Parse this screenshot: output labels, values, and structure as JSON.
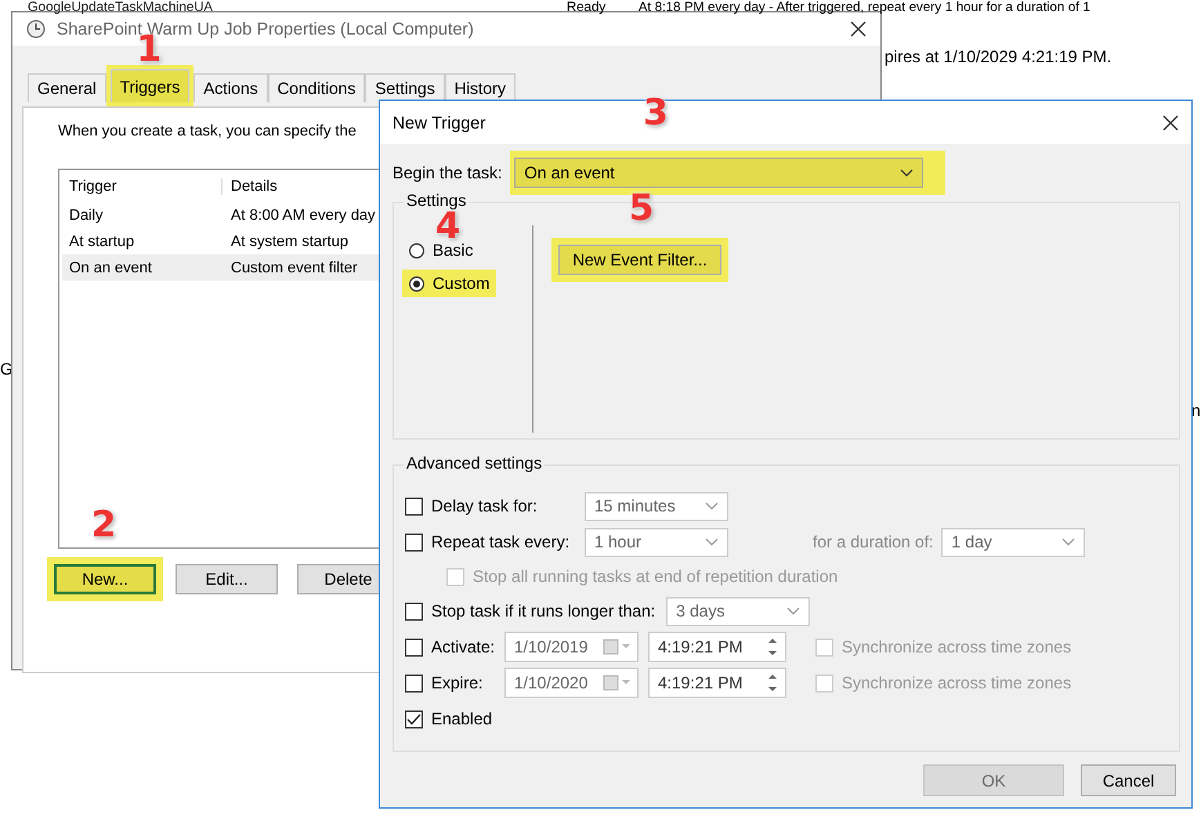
{
  "background": {
    "task_name": "GoogleUpdateTaskMachineUA",
    "task_status": "Ready",
    "task_triggers": "At 8:18 PM every day - After triggered, repeat every 1 hour for a duration of 1",
    "second_line": "pires at 1/10/2029 4:21:19 PM.",
    "left_text": "G",
    "right_text": "n"
  },
  "properties_window": {
    "title": "SharePoint Warm Up Job Properties (Local Computer)",
    "tabs": [
      {
        "label": "General",
        "selected": false,
        "highlighted": false
      },
      {
        "label": "Triggers",
        "selected": true,
        "highlighted": true,
        "callout": "1"
      },
      {
        "label": "Actions",
        "selected": false,
        "highlighted": false
      },
      {
        "label": "Conditions",
        "selected": false,
        "highlighted": false
      },
      {
        "label": "Settings",
        "selected": false,
        "highlighted": false
      },
      {
        "label": "History",
        "selected": false,
        "highlighted": false
      }
    ],
    "intro": "When you create a task, you can specify the",
    "columns": [
      "Trigger",
      "Details"
    ],
    "rows": [
      {
        "trigger": "Daily",
        "details": "At 8:00 AM every day",
        "selected": false
      },
      {
        "trigger": "At startup",
        "details": "At system startup",
        "selected": false
      },
      {
        "trigger": "On an event",
        "details": "Custom event filter",
        "selected": true
      }
    ],
    "buttons": [
      {
        "label": "New...",
        "highlighted": true,
        "callout": "2"
      },
      {
        "label": "Edit...",
        "highlighted": false
      },
      {
        "label": "Delete",
        "highlighted": false
      }
    ]
  },
  "new_trigger_dialog": {
    "title": "New Trigger",
    "begin_label": "Begin the task:",
    "begin_value": "On an event",
    "begin_highlighted": true,
    "begin_callout": "3",
    "settings_title": "Settings",
    "schedule_options": [
      {
        "label": "Basic",
        "selected": false,
        "highlighted": false
      },
      {
        "label": "Custom",
        "selected": true,
        "highlighted": true,
        "callout": "4"
      }
    ],
    "filter_button": {
      "label": "New Event Filter...",
      "highlighted": true,
      "callout": "5"
    },
    "advanced_title": "Advanced settings",
    "advanced": [
      {
        "kind": "combo",
        "label": "Delay task for:",
        "checked": false,
        "value": "15 minutes"
      },
      {
        "kind": "repeat",
        "label": "Repeat task every:",
        "checked": false,
        "value": "1 hour",
        "extra_label": "for a duration of:",
        "extra_value": "1 day"
      },
      {
        "kind": "sub",
        "label": "Stop all running tasks at end of repetition duration",
        "checked": false
      },
      {
        "kind": "combo",
        "label": "Stop task if it runs longer than:",
        "checked": false,
        "value": "3 days"
      },
      {
        "kind": "datetime",
        "label": "Activate:",
        "checked": false,
        "date": "1/10/2019",
        "time": "4:19:21 PM",
        "sync_label": "Synchronize across time zones",
        "sync_checked": false
      },
      {
        "kind": "datetime",
        "label": "Expire:",
        "checked": false,
        "date": "1/10/2020",
        "time": "4:19:21 PM",
        "sync_label": "Synchronize across time zones",
        "sync_checked": false
      },
      {
        "kind": "check",
        "label": "Enabled",
        "checked": true
      }
    ],
    "buttons": [
      {
        "label": "OK",
        "disabled": true
      },
      {
        "label": "Cancel",
        "disabled": false
      }
    ]
  }
}
